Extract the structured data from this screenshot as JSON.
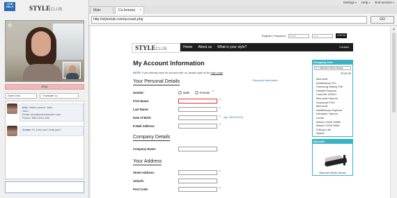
{
  "top_links": [
    "Settings",
    "Help",
    "End session"
  ],
  "left_panel": {
    "logo_line1": "LIVE",
    "logo_line2": "HELP",
    "brand_bold": "STYLE",
    "brand_light": "CLUB",
    "stop_label": "Stop",
    "save_chat": "Save chat",
    "translate": "Translate to...",
    "messages": [
      {
        "who": "Info:",
        "lines": [
          "Visitor joined: John",
          "John",
          "Email: john@somedomain.com",
          "Phone: 555-1244-145"
        ]
      },
      {
        "who": "Jovan:",
        "lines": [
          "Hi, how can I help you?"
        ]
      }
    ],
    "chat_input_value": ""
  },
  "tabs": [
    {
      "label": "Main Menu",
      "active": false
    },
    {
      "label": "Co-browse",
      "active": true,
      "close": "×"
    }
  ],
  "address": {
    "url": "http://styleclub.com/account.php",
    "go_label": "GO"
  },
  "site": {
    "login": {
      "register_label": "Register | Password",
      "email_placeholder": "Email",
      "password_placeholder": "••••••",
      "login_label": "LOG IN"
    },
    "nav": {
      "logo_bold": "STYLE",
      "logo_light": "CLUB",
      "items": [
        "Home",
        "About us",
        "What is your style?"
      ],
      "contact": "Contact"
    },
    "form": {
      "title": "My Account Information",
      "note_label": "NOTE:",
      "note_text": "If you already have an account with us, please login at the",
      "note_link": "login page",
      "note_end": ".",
      "required_info": "* Required information",
      "personal_section": "Your Personal Details",
      "gender_label": "Gender:",
      "male": "Male",
      "female": "Female",
      "first_name": "First Name:",
      "last_name": "Last Name:",
      "dob": "Date of Birth:",
      "dob_hint": "(eg. 05/21/1970)",
      "email": "E-Mail Address:",
      "company_section": "Company Details",
      "company_name": "Company Name:",
      "address_section": "Your Address",
      "street": "Street Address:",
      "suburb": "Suburb:",
      "post_code": "Post Code:",
      "star": "*"
    },
    "cart": {
      "title": "Shopping Cart",
      "selected": "1 × Glimmer Retro Shoes",
      "total": "$749.99",
      "items": [
        "Microsoft",
        "IntelliMouse Pro",
        "Samsung Galaxy Tab",
        "Hewlett Packard",
        "LaserJet 1100Xi",
        "Microsoft Internet",
        "Keyboard PS/2",
        "Microsoft",
        "IntelliMouse Explorer",
        "Disciples: Sacred",
        "Lands",
        "Matrox G400 32MB",
        "Matrox G200 MMS",
        "A Bug's Life",
        "Speed"
      ],
      "specials_title": "Specials",
      "special_item": "Glimmer Retro Shoes"
    }
  }
}
